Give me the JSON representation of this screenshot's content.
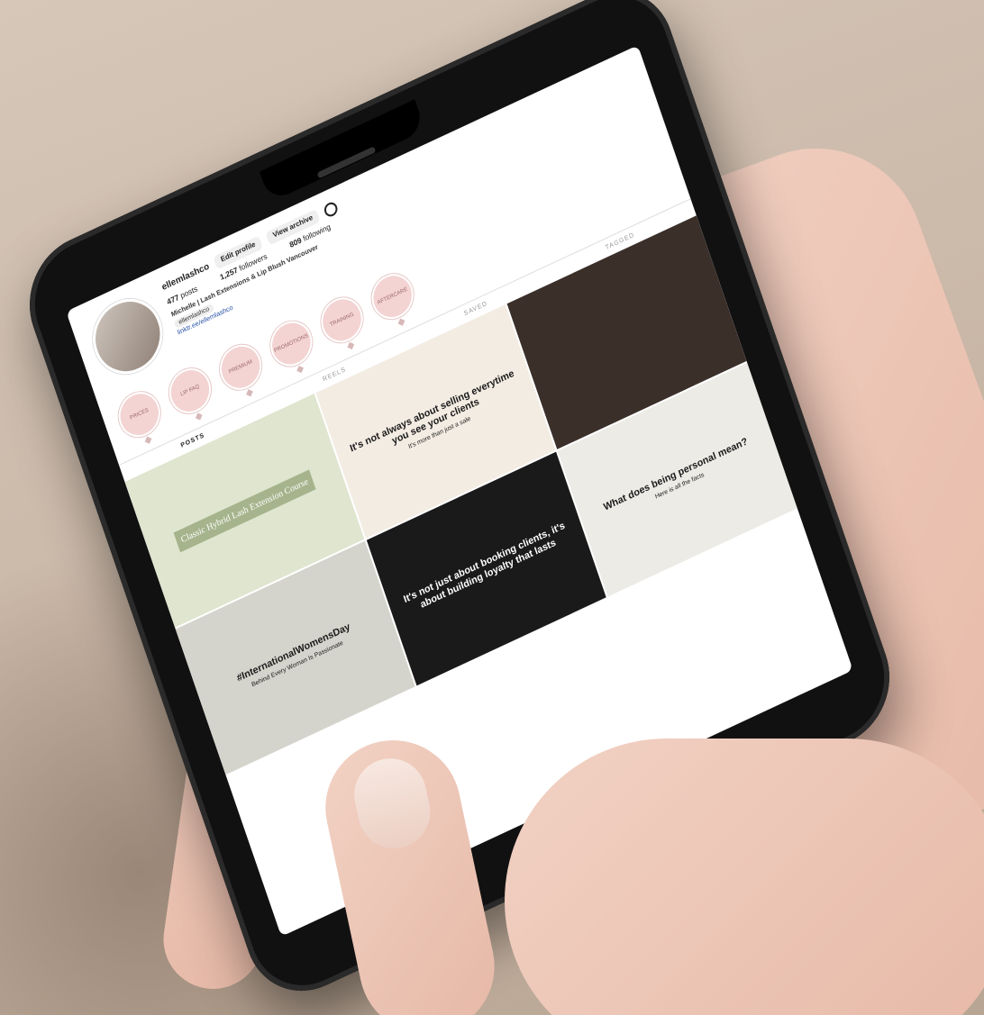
{
  "profile": {
    "handle": "ellemlashco",
    "edit_profile": "Edit profile",
    "view_archive": "View archive",
    "posts_count": "477",
    "posts_label": "posts",
    "followers_count": "1,257",
    "followers_label": "followers",
    "following_count": "809",
    "following_label": "following",
    "name": "Michelle | Lash Extensions & Lip Blush Vancouver",
    "tag": "ellemlashco",
    "link": "linktr.ee/ellemlashco"
  },
  "highlights": [
    "PRICES",
    "LIP FAQ",
    "PREMIUM",
    "PROMOTIONS",
    "TRAINING",
    "AFTERCARE"
  ],
  "tabs": [
    "POSTS",
    "REELS",
    "SAVED",
    "TAGGED"
  ],
  "posts": {
    "p1_title": "Classic Hybrid Lash Extension Course",
    "p2_title": "It's not always about selling everytime you see your clients",
    "p2_sub": "It's more than just a sale",
    "p3_title": "",
    "p4_title": "#InternationalWomensDay",
    "p4_sub": "Behind Every Woman Is Passionate",
    "p5_title": "It's not just about booking clients, it's about building loyalty that lasts",
    "p6_title": "What does being personal mean?",
    "p6_sub": "Here is all the facts"
  },
  "colors": {
    "highlight_pink": "#f4d3d3",
    "phone_black": "#111111",
    "background": "#cbb9a9"
  }
}
